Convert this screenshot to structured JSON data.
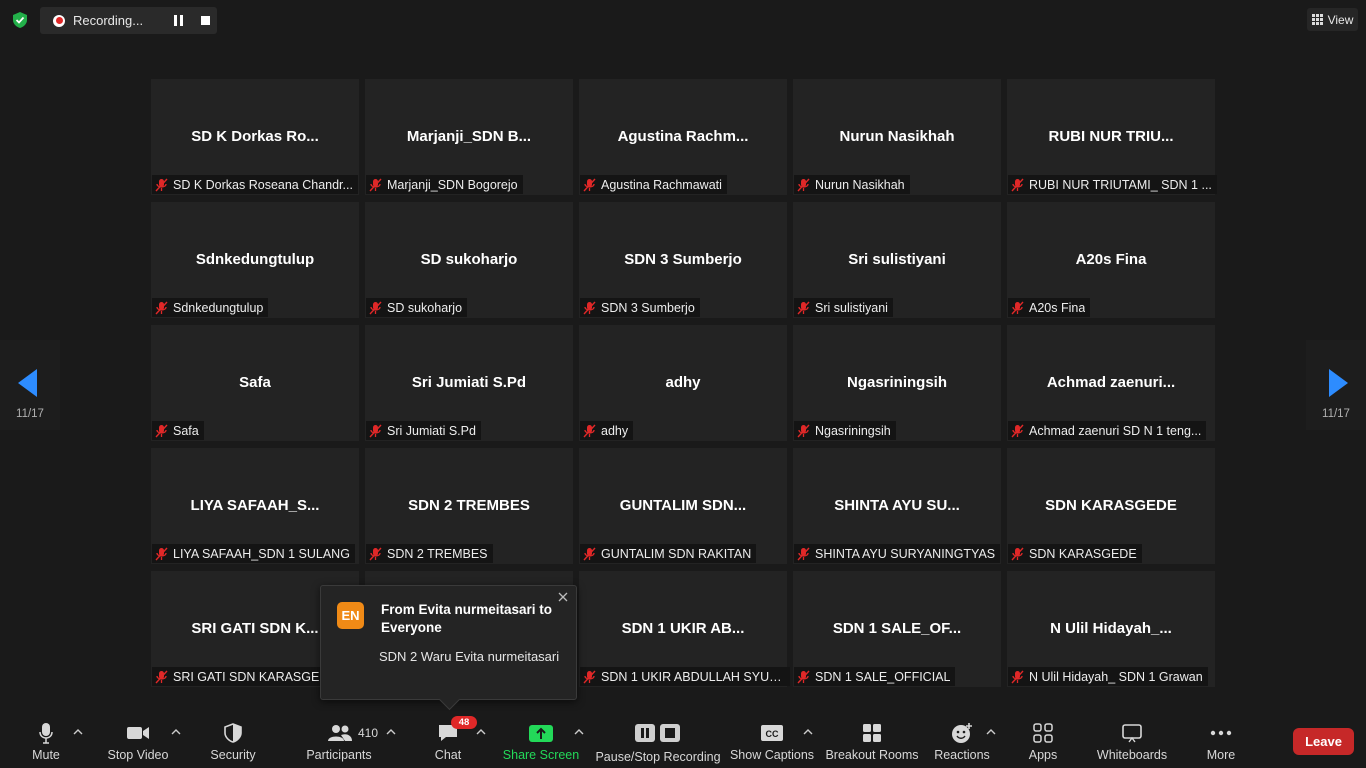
{
  "recording": {
    "status": "Recording..."
  },
  "view_button": {
    "label": "View"
  },
  "pagination": {
    "left": "11/17",
    "right": "11/17"
  },
  "tiles": [
    {
      "big": "SD K Dorkas Ro...",
      "name": "SD K Dorkas Roseana Chandr..."
    },
    {
      "big": "Marjanji_SDN  B...",
      "name": "Marjanji_SDN Bogorejo"
    },
    {
      "big": "Agustina  Rachm...",
      "name": "Agustina Rachmawati"
    },
    {
      "big": "Nurun Nasikhah",
      "name": "Nurun Nasikhah"
    },
    {
      "big": "RUBI NUR TRIU...",
      "name": "RUBI NUR TRIUTAMI_ SDN 1 ..."
    },
    {
      "big": "Sdnkedungtulup",
      "name": "Sdnkedungtulup"
    },
    {
      "big": "SD sukoharjo",
      "name": "SD sukoharjo"
    },
    {
      "big": "SDN 3 Sumberjo",
      "name": "SDN 3 Sumberjo"
    },
    {
      "big": "Sri sulistiyani",
      "name": "Sri sulistiyani"
    },
    {
      "big": "A20s Fina",
      "name": "A20s Fina"
    },
    {
      "big": "Safa",
      "name": "Safa"
    },
    {
      "big": "Sri Jumiati S.Pd",
      "name": "Sri Jumiati S.Pd"
    },
    {
      "big": "adhy",
      "name": "adhy"
    },
    {
      "big": "Ngasriningsih",
      "name": "Ngasriningsih"
    },
    {
      "big": "Achmad  zaenuri...",
      "name": "Achmad zaenuri SD N 1 teng..."
    },
    {
      "big": "LIYA  SAFAAH_S...",
      "name": "LIYA SAFAAH_SDN 1 SULANG"
    },
    {
      "big": "SDN 2 TREMBES",
      "name": "SDN 2 TREMBES"
    },
    {
      "big": "GUNTALIM  SDN...",
      "name": "GUNTALIM SDN RAKITAN"
    },
    {
      "big": "SHINTA  AYU  SU...",
      "name": "SHINTA AYU SURYANINGTYAS"
    },
    {
      "big": "SDN KARASGEDE",
      "name": "SDN KARASGEDE"
    },
    {
      "big": "SRI GATI SDN K...",
      "name": "SRI GATI SDN KARASGEDE"
    },
    {
      "big": "",
      "name": ""
    },
    {
      "big": "SDN 1 UKIR AB...",
      "name": "SDN 1 UKIR ABDULLAH SYUK..."
    },
    {
      "big": "SDN  1  SALE_OF...",
      "name": "SDN 1 SALE_OFFICIAL"
    },
    {
      "big": "N  Ulil  Hidayah_...",
      "name": "N Ulil Hidayah_ SDN 1 Grawan"
    }
  ],
  "chat_toast": {
    "avatar": "EN",
    "title": "From Evita nurmeitasari to Everyone",
    "message": "SDN 2 Waru Evita nurmeitasari"
  },
  "toolbar": {
    "mute": "Mute",
    "stop_video": "Stop Video",
    "security": "Security",
    "participants": "Participants",
    "participants_count": "410",
    "chat": "Chat",
    "chat_badge": "48",
    "share_screen": "Share Screen",
    "pause_stop_recording": "Pause/Stop Recording",
    "show_captions": "Show Captions",
    "breakout_rooms": "Breakout Rooms",
    "reactions": "Reactions",
    "apps": "Apps",
    "whiteboards": "Whiteboards",
    "more": "More",
    "leave": "Leave"
  },
  "colors": {
    "accent_green": "#23d959",
    "leave_red": "#c62828",
    "nav_blue": "#2d8cff",
    "muted_red": "#e02828"
  }
}
